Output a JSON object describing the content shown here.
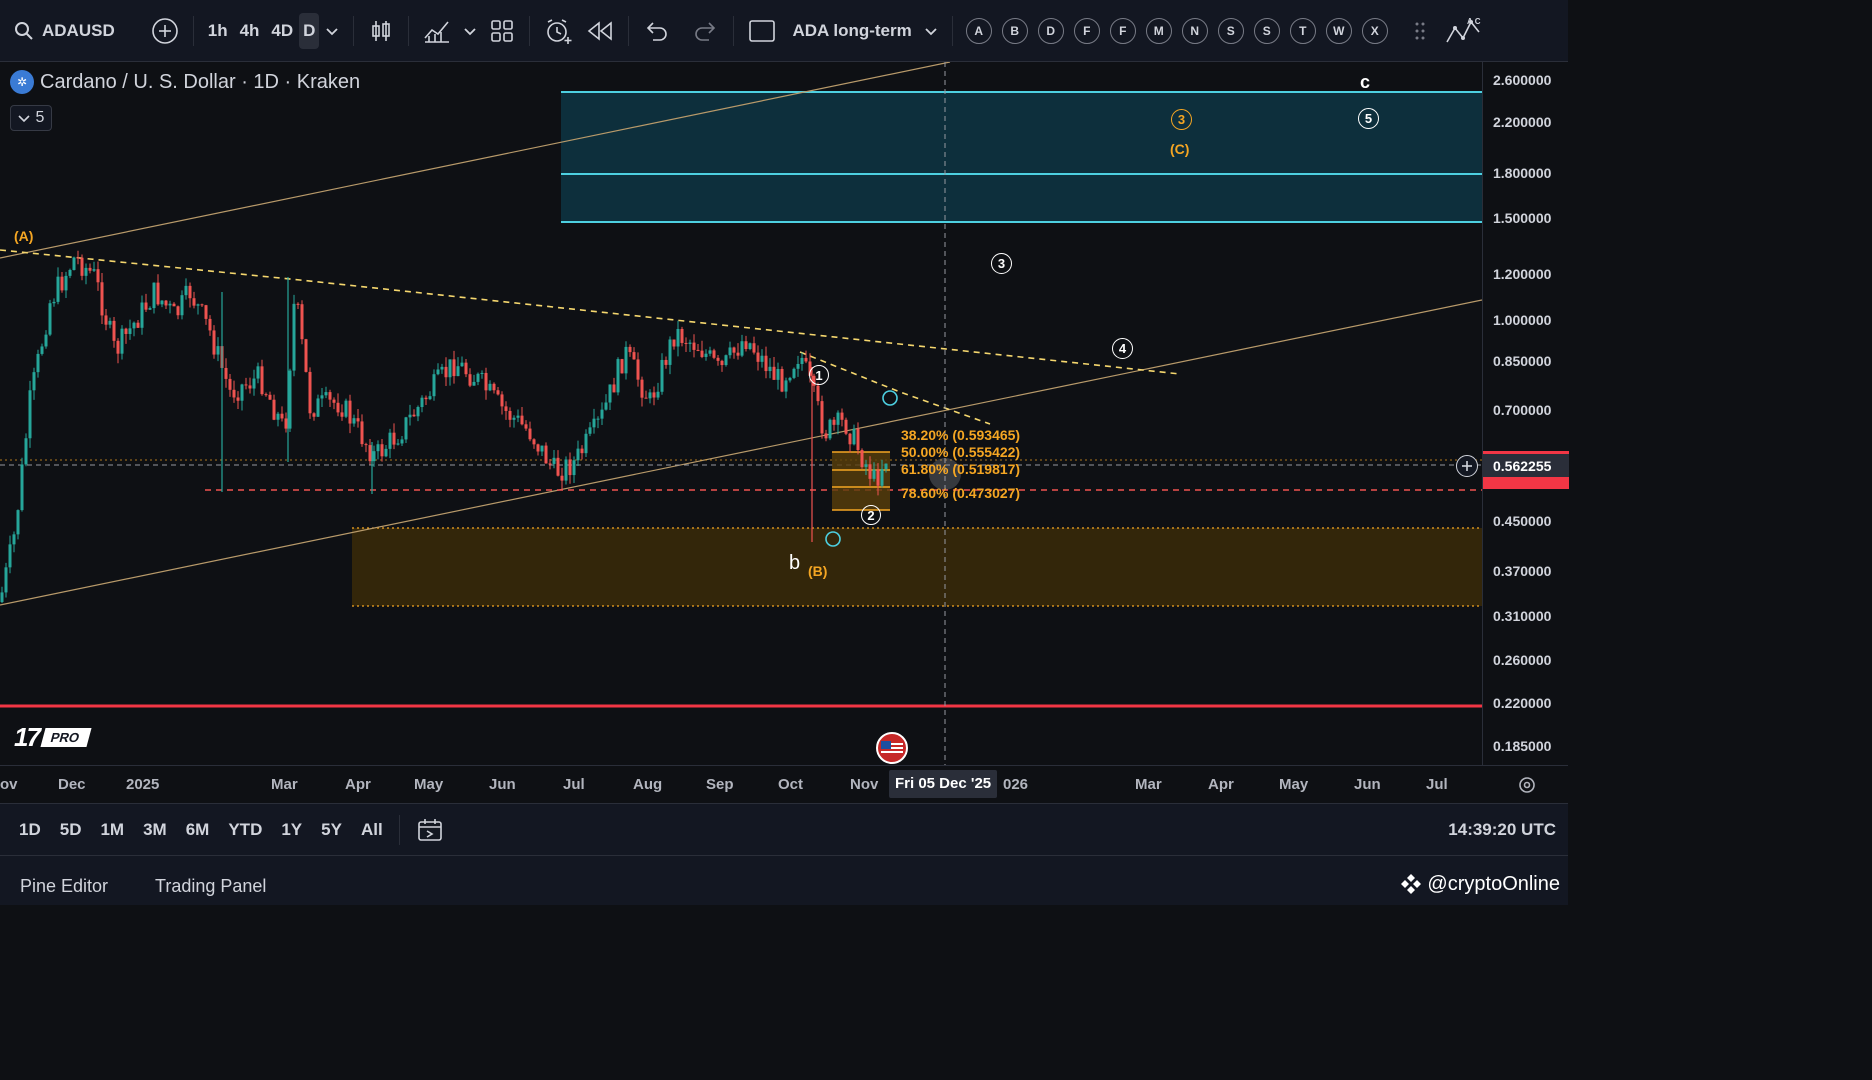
{
  "toolbar": {
    "symbol": "ADAUSD",
    "intervals": [
      "1h",
      "4h",
      "4D",
      "D"
    ],
    "active_interval": "D",
    "layout_name": "ADA long-term",
    "watchlist_letters": [
      "A",
      "B",
      "D",
      "F",
      "F",
      "M",
      "N",
      "S",
      "S",
      "T",
      "W",
      "X"
    ]
  },
  "legend": {
    "title": "Cardano / U. S. Dollar · 1D · Kraken",
    "collapse_count": "5"
  },
  "price_axis": {
    "ticks": [
      "2.600000",
      "2.200000",
      "1.800000",
      "1.500000",
      "1.200000",
      "1.000000",
      "0.850000",
      "0.700000",
      "0.450000",
      "0.370000",
      "0.310000",
      "0.260000",
      "0.220000",
      "0.185000"
    ],
    "current_price": "0.562255"
  },
  "time_axis": {
    "ticks": [
      "ov",
      "Dec",
      "2025",
      "Mar",
      "Apr",
      "May",
      "Jun",
      "Jul",
      "Aug",
      "Sep",
      "Oct",
      "Nov",
      "026",
      "Mar",
      "Apr",
      "May",
      "Jun",
      "Jul"
    ],
    "crosshair_label": "Fri 05 Dec '25"
  },
  "fib_levels": [
    {
      "label": "38.20% (0.593465)"
    },
    {
      "label": "50.00% (0.555422)"
    },
    {
      "label": "61.80% (0.519817)"
    },
    {
      "label": "78.60% (0.473027)"
    }
  ],
  "wave_labels": {
    "A": "(A)",
    "B": "(B)",
    "C": "(C)",
    "b": "b",
    "c": "c",
    "w1": "1",
    "w2": "2",
    "w3": "3",
    "w4": "4",
    "w5": "5",
    "w3_orange": "3"
  },
  "range_bar": {
    "ranges": [
      "1D",
      "5D",
      "1M",
      "3M",
      "6M",
      "YTD",
      "1Y",
      "5Y",
      "All"
    ],
    "clock": "14:39:20 UTC"
  },
  "footer": {
    "tab1": "Pine Editor",
    "tab2": "Trading Panel",
    "watermark": "@cryptoOnline"
  },
  "branding": {
    "tv_pro": "PRO"
  },
  "colors": {
    "bull": "#26a69a",
    "bear": "#ef5350",
    "cyan": "#4dd0e1",
    "orange": "#f5a623",
    "red_line": "#f23645"
  }
}
